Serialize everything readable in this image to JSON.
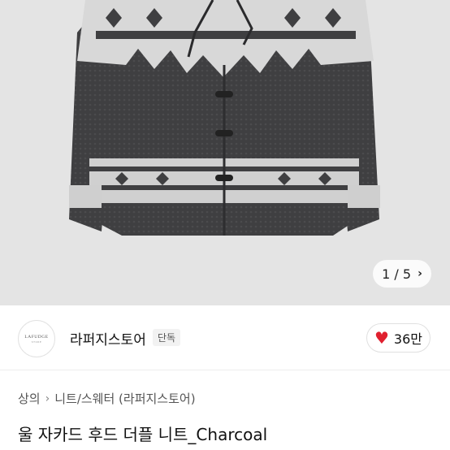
{
  "gallery": {
    "current": "1",
    "separator": "/",
    "total": "5",
    "next_icon": "chevron-right-icon"
  },
  "seller": {
    "logo_text": "LAFUDGE",
    "logo_sub": "STORE",
    "name": "라퍼지스토어",
    "badge": "단독"
  },
  "like": {
    "icon": "heart-icon",
    "color": "#e0202f",
    "count": "36만"
  },
  "breadcrumb": {
    "level1": "상의",
    "level2": "니트/스웨터 (라퍼지스토어)"
  },
  "product": {
    "title": "울 자카드 후드 더플 니트_Charcoal"
  }
}
